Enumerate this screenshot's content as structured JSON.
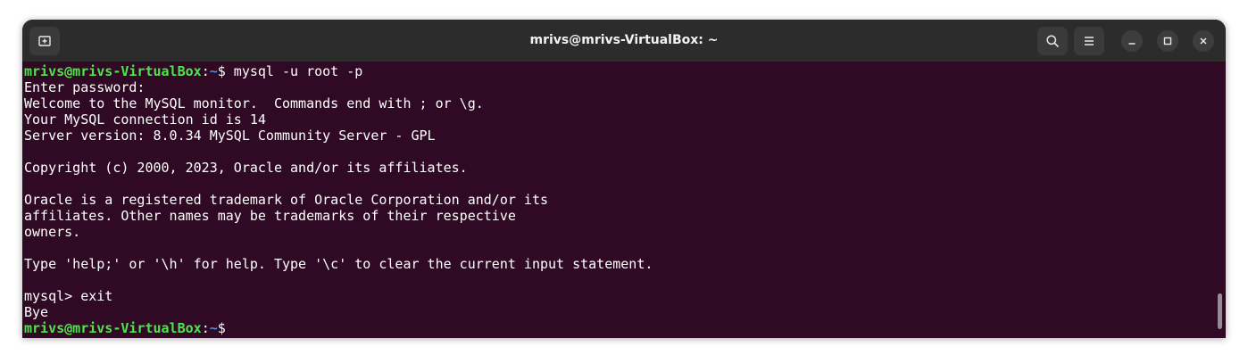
{
  "window": {
    "title": "mrivs@mrivs-VirtualBox: ~"
  },
  "titlebar": {
    "new_tab_icon": "new-tab-icon",
    "search_icon": "search-icon",
    "menu_icon": "hamburger-menu-icon",
    "minimize_icon": "minimize-icon",
    "maximize_icon": "maximize-icon",
    "close_icon": "close-icon"
  },
  "prompt": {
    "user_host": "mrivs@mrivs-VirtualBox",
    "separator": ":",
    "path": "~",
    "symbol": "$"
  },
  "terminal": {
    "command_1": " mysql -u root -p",
    "output": [
      "Enter password:",
      "Welcome to the MySQL monitor.  Commands end with ; or \\g.",
      "Your MySQL connection id is 14",
      "Server version: 8.0.34 MySQL Community Server - GPL",
      "",
      "Copyright (c) 2000, 2023, Oracle and/or its affiliates.",
      "",
      "Oracle is a registered trademark of Oracle Corporation and/or its",
      "affiliates. Other names may be trademarks of their respective",
      "owners.",
      "",
      "Type 'help;' or '\\h' for help. Type '\\c' to clear the current input statement.",
      "",
      "mysql> exit",
      "Bye"
    ],
    "command_2": ""
  },
  "colors": {
    "terminal_bg": "#300a24",
    "titlebar_bg": "#2c2c2c",
    "prompt_user": "#4ee44c",
    "prompt_path": "#4f8ede"
  }
}
